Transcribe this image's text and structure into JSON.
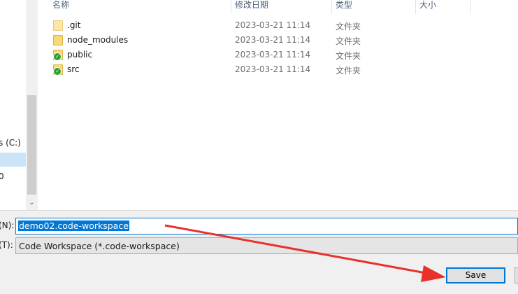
{
  "nav": {
    "drive_label": "s (C:)",
    "partial_item": "0"
  },
  "columns": {
    "name": "名称",
    "date": "修改日期",
    "type": "类型",
    "size": "大小"
  },
  "files": [
    {
      "name": ".git",
      "date": "2023-03-21 11:14",
      "type": "文件夹",
      "icon": "folder-icon",
      "badge": false
    },
    {
      "name": "node_modules",
      "date": "2023-03-21 11:14",
      "type": "文件夹",
      "icon": "folder-icon",
      "badge": false
    },
    {
      "name": "public",
      "date": "2023-03-21 11:14",
      "type": "文件夹",
      "icon": "folder-synced-icon",
      "badge": true
    },
    {
      "name": "src",
      "date": "2023-03-21 11:14",
      "type": "文件夹",
      "icon": "folder-synced-icon",
      "badge": true
    }
  ],
  "form": {
    "filename_label": "(N):",
    "filename_value": "demo02.code-workspace",
    "filetype_label": "(T):",
    "filetype_value": "Code Workspace (*.code-workspace)"
  },
  "buttons": {
    "save": "Save"
  },
  "colors": {
    "accent": "#0078d7",
    "annotation_arrow": "#e8312b"
  }
}
